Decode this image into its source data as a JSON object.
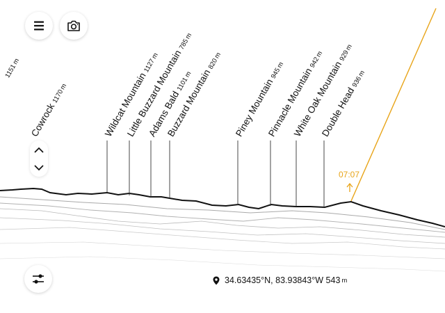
{
  "controls": {
    "menu_icon": "hamburger-menu-icon",
    "camera_icon": "camera-icon",
    "scroll_up_icon": "chevron-up-icon",
    "scroll_down_icon": "chevron-down-icon",
    "settings_icon": "sliders-icon"
  },
  "colors": {
    "sun": "#e8a418",
    "ink": "#111111",
    "terrain": "#1a1a1a"
  },
  "sun": {
    "time": "07:07"
  },
  "location": {
    "lat": "34.63435°N",
    "lon": "83.93843°W",
    "elevation": "543",
    "unit": "m"
  },
  "peaks": [
    {
      "name": "",
      "elevation": "1151",
      "unit": "m"
    },
    {
      "name": "Cowrock",
      "elevation": "1170",
      "unit": "m"
    },
    {
      "name": "Wildcat Mountain",
      "elevation": "1127",
      "unit": "m"
    },
    {
      "name": "Little Buzzard Mountain",
      "elevation": "785",
      "unit": "m"
    },
    {
      "name": "Adams Bald",
      "elevation": "1101",
      "unit": "m"
    },
    {
      "name": "Buzzard Mountain",
      "elevation": "820",
      "unit": "m"
    },
    {
      "name": "Piney Mountain",
      "elevation": "945",
      "unit": "m"
    },
    {
      "name": "Pinnacle Mountain",
      "elevation": "942",
      "unit": "m"
    },
    {
      "name": "White Oak Mountain",
      "elevation": "929",
      "unit": "m"
    },
    {
      "name": "Double Head",
      "elevation": "936",
      "unit": "m"
    }
  ]
}
